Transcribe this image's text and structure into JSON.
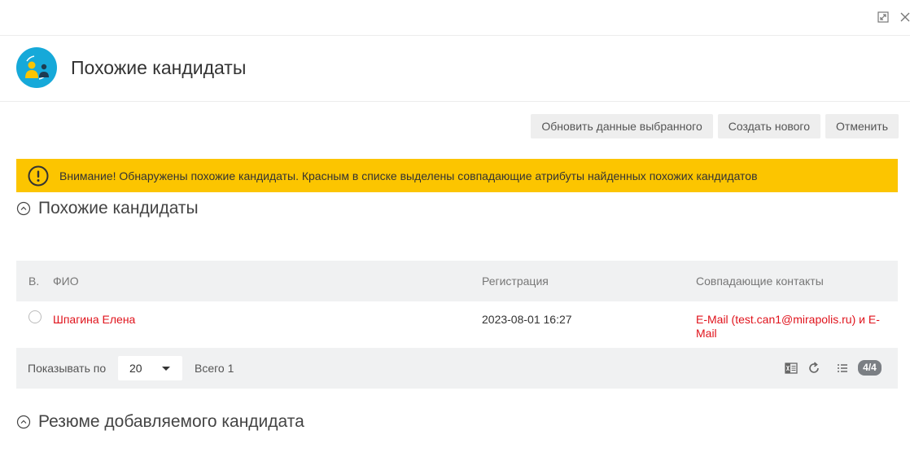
{
  "window": {
    "expand_icon": "expand-icon",
    "close_icon": "close-icon"
  },
  "header": {
    "icon": "candidates-icon",
    "title": "Похожие кандидаты"
  },
  "actions": {
    "update_label": "Обновить данные выбранного",
    "create_label": "Создать нового",
    "cancel_label": "Отменить"
  },
  "alert": {
    "icon": "warning-icon",
    "text": "Внимание! Обнаружены похожие кандидаты. Красным в списке выделены совпадающие атрибуты найденных похожих кандидатов",
    "color": "#fcc500"
  },
  "section_similar": {
    "title": "Похожие кандидаты"
  },
  "table": {
    "columns": [
      "В.",
      "ФИО",
      "Регистрация",
      "Совпадающие контакты"
    ],
    "rows": [
      {
        "name": "Шпагина Елена",
        "registered": "2023-08-01 16:27",
        "contacts_line1": "E-Mail (test.can1@mirapolis.ru) и E-",
        "contacts_line2": "Mail"
      }
    ],
    "highlight_color": "#e0131c"
  },
  "footer": {
    "show_label": "Показывать по",
    "page_size": "20",
    "total_label": "Всего 1",
    "badge": "4/4"
  },
  "section_resume": {
    "title": "Резюме добавляемого кандидата"
  },
  "colors": {
    "accent": "#16a9d9",
    "table_bg": "#f0f1f2",
    "button_bg": "#eeeeee"
  }
}
